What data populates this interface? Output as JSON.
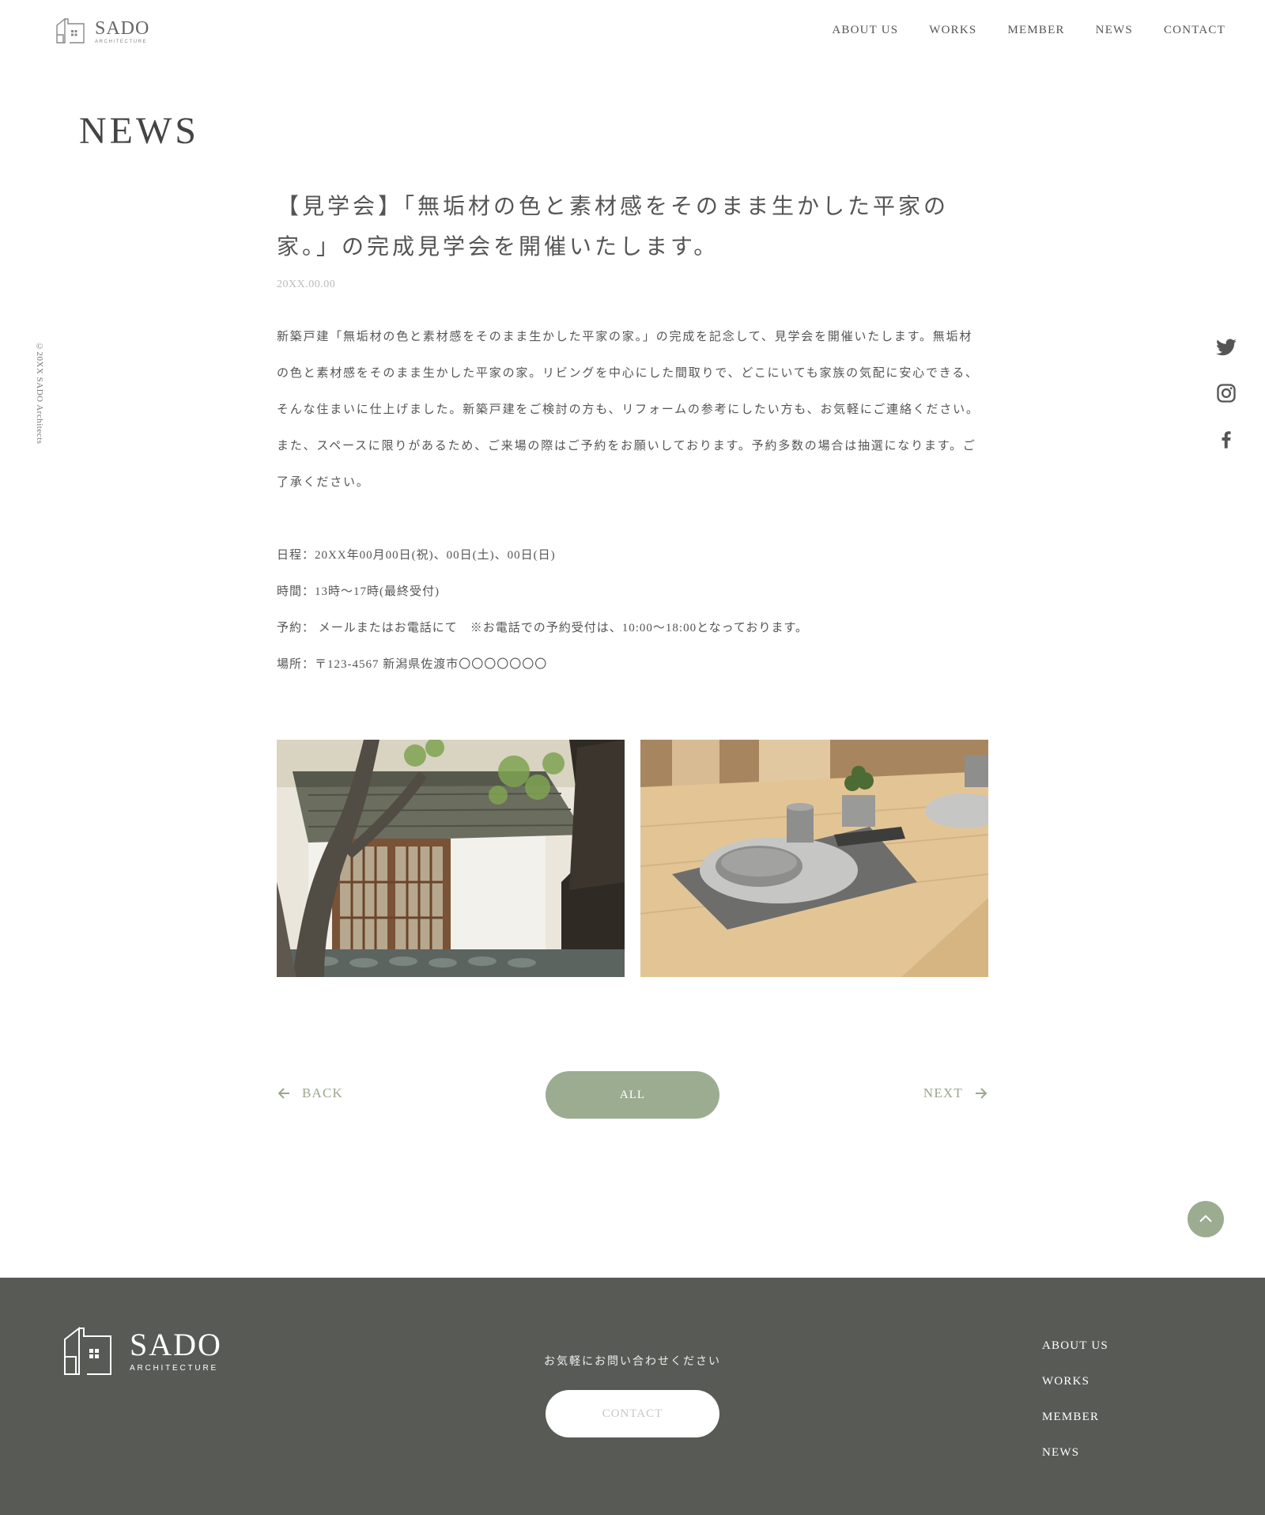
{
  "brand": {
    "name": "SADO",
    "sub": "ARCHITECTURE"
  },
  "nav": {
    "items": [
      {
        "label": "ABOUT US"
      },
      {
        "label": "WORKS"
      },
      {
        "label": "MEMBER"
      },
      {
        "label": "NEWS"
      },
      {
        "label": "CONTACT"
      }
    ]
  },
  "page": {
    "title": "NEWS",
    "copyright": "©20XX SADO Architects"
  },
  "social": {
    "icons": [
      "twitter-icon",
      "instagram-icon",
      "facebook-icon"
    ]
  },
  "article": {
    "title_line1": "【見学会】「無垢材の色と素材感をそのまま生かした平家の",
    "title_line2": "家。」の完成見学会を開催いたします。",
    "date": "20XX.00.00",
    "body_lines": [
      "新築戸建「無垢材の色と素材感をそのまま生かした平家の家。」の完成を記念して、見学会を開催いたします。無垢材",
      "の色と素材感をそのまま生かした平家の家。リビングを中心にした間取りで、どこにいても家族の気配に安心できる、",
      "そんな住まいに仕上げました。新築戸建をご検討の方も、リフォームの参考にしたい方も、お気軽にご連絡ください。",
      "また、スペースに限りがあるため、ご来場の際はご予約をお願いしております。予約多数の場合は抽選になります。ご",
      "了承ください。"
    ],
    "info": {
      "schedule": "日程：20XX年00月00日(祝)、00日(土)、00日(日)",
      "time": "時間：13時〜17時(最終受付)",
      "reservation": "予約： メールまたはお電話にて　※お電話での予約受付は、10:00〜18:00となっております。",
      "place": "場所：〒123-4567 新潟県佐渡市〇〇〇〇〇〇〇"
    }
  },
  "pager": {
    "back": "BACK",
    "all": "ALL",
    "next": "NEXT"
  },
  "footer": {
    "lead": "お気軽にお問い合わせください",
    "contact": "CONTACT",
    "nav": [
      {
        "label": "ABOUT US"
      },
      {
        "label": "WORKS"
      },
      {
        "label": "MEMBER"
      },
      {
        "label": "NEWS"
      }
    ]
  },
  "colors": {
    "accent": "#9cac91",
    "footer_bg": "#585a56",
    "text": "#555555"
  }
}
